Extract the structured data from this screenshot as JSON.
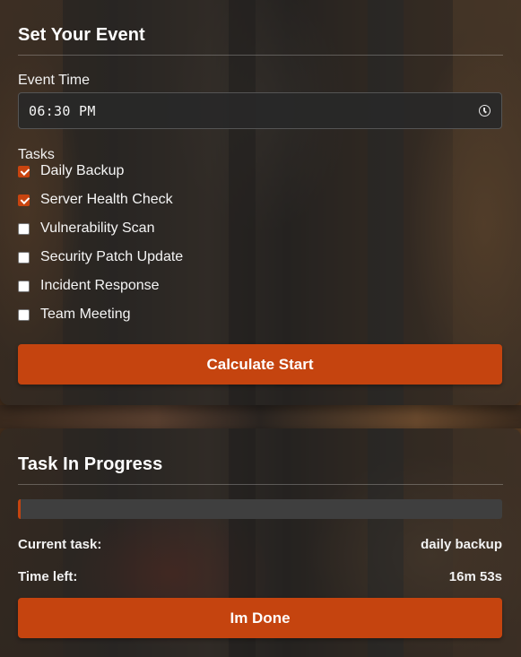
{
  "event_panel": {
    "title": "Set Your Event",
    "time_label": "Event Time",
    "time_value": "06:30 PM",
    "tasks_label": "Tasks",
    "tasks": [
      {
        "label": "Daily Backup",
        "checked": true
      },
      {
        "label": "Server Health Check",
        "checked": true
      },
      {
        "label": "Vulnerability Scan",
        "checked": false
      },
      {
        "label": "Security Patch Update",
        "checked": false
      },
      {
        "label": "Incident Response",
        "checked": false
      },
      {
        "label": "Team Meeting",
        "checked": false
      }
    ],
    "calculate_label": "Calculate Start"
  },
  "progress_panel": {
    "title": "Task In Progress",
    "progress_fraction": 0.005,
    "current_task_label": "Current task:",
    "current_task_value": "daily backup",
    "time_left_label": "Time left:",
    "time_left_value": "16m 53s",
    "done_label": "Im Done"
  },
  "colors": {
    "accent": "#c5440f",
    "panel": "#262626",
    "track": "#3f3f3f"
  },
  "icons": {
    "time_input": "clock-icon"
  }
}
